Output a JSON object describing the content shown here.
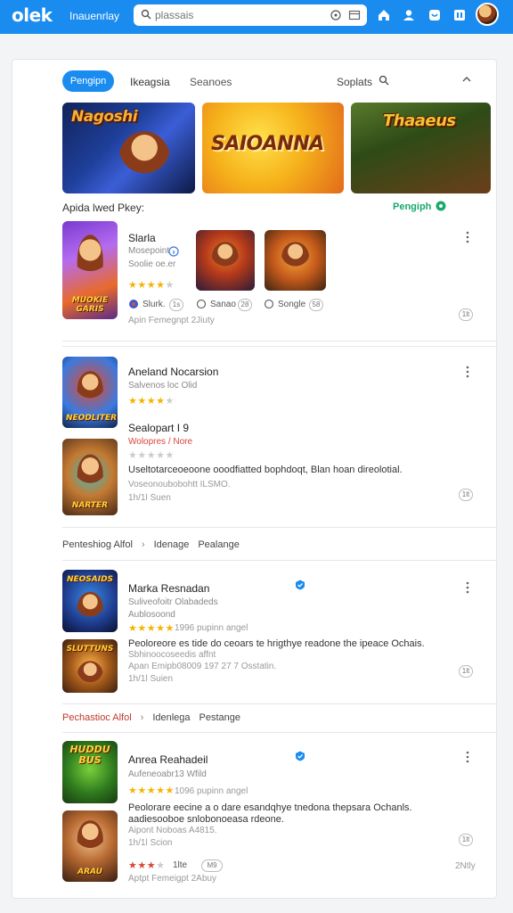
{
  "topbar": {
    "logo": "olek",
    "subtitle": "Inauenrlay",
    "search_placeholder": "plassais",
    "colors": {
      "bar": "#1a8cf0"
    },
    "icons": [
      "search-icon",
      "clear-icon",
      "filter-icon",
      "home-icon",
      "profile-icon",
      "notifications-icon",
      "library-icon"
    ]
  },
  "tabs": {
    "active": "Pengipn",
    "items": [
      "Ikeagsia",
      "Seanoes"
    ],
    "sort_label": "Soplats"
  },
  "banners": [
    "Nagoshi",
    "SAIOANNA",
    "Thaaeus"
  ],
  "featured": {
    "title": "Apida lwed Pkey:",
    "link": "Pengiph",
    "card": {
      "big_thumb_label": "MUOKIE GARIS",
      "name": "Slarla",
      "sub1": "Mosepoint",
      "sub2": "Soolie oe.er",
      "stars": "★★★★",
      "stars_empty": "★",
      "chips": [
        {
          "label": "Slurk.",
          "count": "1s"
        },
        {
          "label": "Sanao",
          "count": "28"
        },
        {
          "label": "Songle",
          "count": "58"
        }
      ],
      "footer": "Apin Femegnpt 2Jiuty",
      "count_badge": "1lt"
    }
  },
  "list1": {
    "item1": {
      "name": "Aneland Nocarsion",
      "sub": "Salvenos loc Olid",
      "stars": "★★★★",
      "stars_empty": "★",
      "thumb_label": "NEODLITER"
    },
    "item2": {
      "name": "Sealopart I 9",
      "sub": "Wolopres / Nore",
      "stars_empty": "★★★★★",
      "desc": "Useltotarceoeoone ooodfiatted bophdoqt, Blan hoan direolotial.",
      "desc2": "Voseonoubobohtt ILSMO.",
      "meta": "1h/1l Suen",
      "count_badge": "1lt",
      "thumb_label": "NARTER"
    }
  },
  "filter1": [
    "Penteshiog Alfol",
    "Idenage",
    "Pealange"
  ],
  "list2": {
    "name": "Marka Resnadan",
    "sub1": "Suliveofoitr Olabadeds",
    "sub2": "Aublosoond",
    "stars": "★★★★★",
    "rating_text": "1996 pupinn angel",
    "desc": "Peoloreore es tide do ceoars te hrigthye readone the ipeace Ochais.",
    "desc2": "Sbhinoocoseedis affnt",
    "meta_line": "Apan Emipb08009 197 27 7 Osstatin.",
    "meta": "1h/1l Suien",
    "count_badge": "1lt",
    "thumb1_label": "NEOSAIDS",
    "thumb2_label": "SLUTTUNS"
  },
  "filter2": [
    "Pechastioc Alfol",
    "Idenlega",
    "Pestange"
  ],
  "list3": {
    "name": "Anrea Reahadeil",
    "sub": "Aufeneoabr13 Wfild",
    "stars": "★★★★★",
    "rating_text": "1096 pupinn angel",
    "desc": "Peolorare eecine a o dare esandqhye tnedona thepsara Ochanls.",
    "desc2": "aadiesooboe snlobonoeasa rdeone.",
    "meta_line": "Aipont Noboas A4815.",
    "meta": "1h/1l Scion",
    "count_badge": "1lt",
    "red_stars": "★★★",
    "red_stars_empty": "★",
    "red_text": "1lte",
    "red_badge": "M9",
    "right_label": "2Ntly",
    "footer": "Aptpt Femeigpt 2Abuy",
    "thumb1_label": "HUDDU BUS",
    "thumb2_label": "ARAU"
  }
}
